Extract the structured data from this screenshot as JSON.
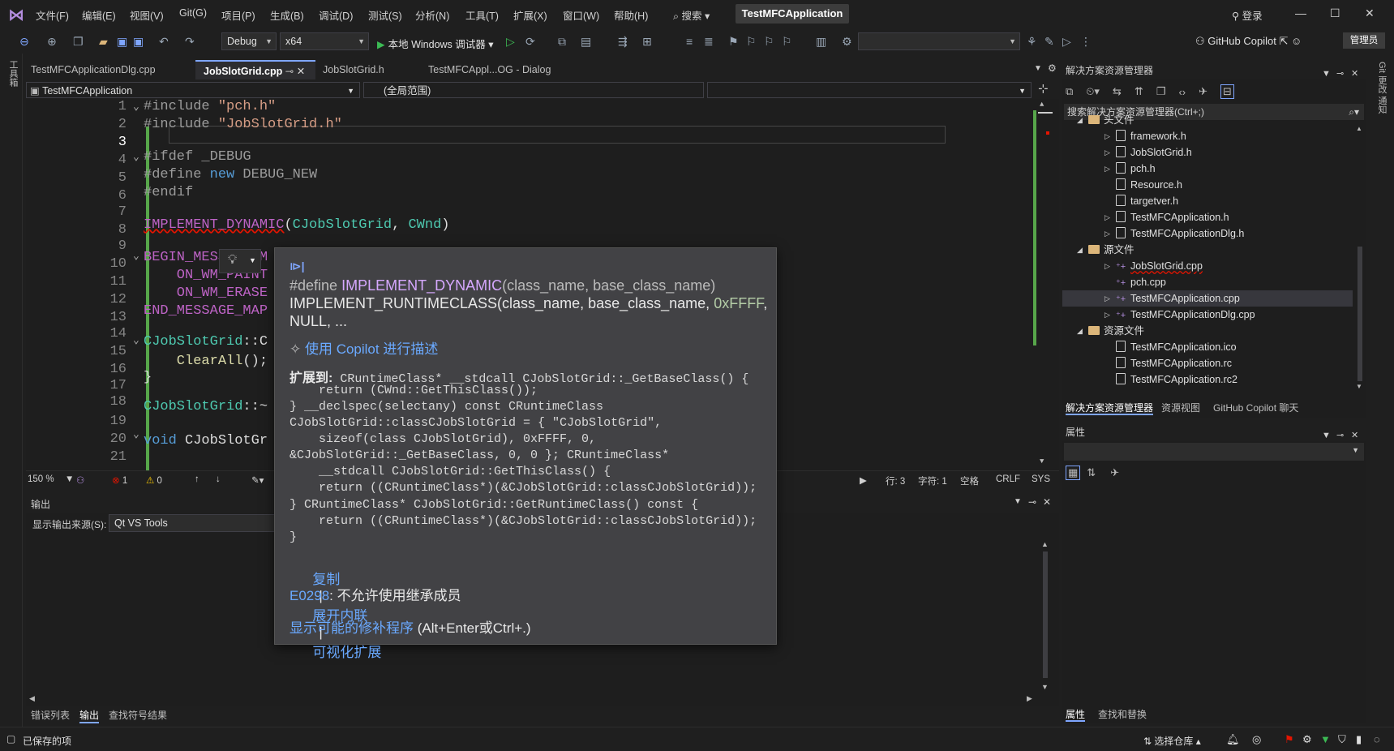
{
  "menubar": {
    "items": [
      "文件(F)",
      "编辑(E)",
      "视图(V)",
      "Git(G)",
      "项目(P)",
      "生成(B)",
      "调试(D)",
      "测试(S)",
      "分析(N)",
      "工具(T)",
      "扩展(X)",
      "窗口(W)",
      "帮助(H)"
    ],
    "search_label": "搜索",
    "solution_title": "TestMFCApplication",
    "login_label": "登录"
  },
  "toolbar": {
    "config": "Debug",
    "platform": "x64",
    "run_label": "本地 Windows 调试器",
    "copilot_label": "GitHub Copilot",
    "admin_label": "管理员"
  },
  "left_strip": {
    "label": "工具箱"
  },
  "right_strip": {
    "label": "Git 更改 通知"
  },
  "doc_tabs": [
    {
      "label": "TestMFCApplicationDlg.cpp",
      "active": false
    },
    {
      "label": "JobSlotGrid.cpp",
      "active": true
    },
    {
      "label": "JobSlotGrid.h",
      "active": false
    },
    {
      "label": "TestMFCAppl...OG - Dialog",
      "active": false
    }
  ],
  "navbar": {
    "project": "TestMFCApplication",
    "scope": "(全局范围)"
  },
  "code": {
    "line_numbers": [
      "1",
      "2",
      "3",
      "4",
      "5",
      "6",
      "7",
      "8",
      "9",
      "10",
      "11",
      "12",
      "13",
      "14",
      "15",
      "16",
      "17",
      "18",
      "19",
      "20",
      "21"
    ],
    "l1_pp": "#include",
    "l1_str": "\"pch.h\"",
    "l2_pp": "#include",
    "l2_str": "\"JobSlotGrid.h\"",
    "l4_pp": "#ifdef",
    "l4_rest": " _DEBUG",
    "l5_pp": "#define",
    "l5_kw": " new",
    "l5_rest": " DEBUG_NEW",
    "l6_pp": "#endif",
    "l8_mac": "IMPLEMENT_DYNAMIC",
    "l8_open": "(",
    "l8_cls1": "CJobSlotGrid",
    "l8_sep": ", ",
    "l8_cls2": "CWnd",
    "l8_close": ")",
    "l10": "BEGIN_MESSAGE_M",
    "l11": "    ON_WM_PAINT",
    "l12": "    ON_WM_ERASE",
    "l13": "END_MESSAGE_MAP",
    "l15_cls": "CJobSlotGrid",
    "l15_rest": "::C",
    "l16_fn": "    ClearAll",
    "l16_rest": "();",
    "l17": "}",
    "l19_cls": "CJobSlotGrid",
    "l19_rest": "::~",
    "l21_kw": "void",
    "l21_rest": " CJobSlotGr"
  },
  "editor_status": {
    "zoom": "150 %",
    "errors": "1",
    "warnings": "0",
    "line": "行: 3",
    "char": "字符: 1",
    "spaces": "空格",
    "eol": "CRLF",
    "encoding": "SYS"
  },
  "quickinfo": {
    "line1_pp": "#define",
    "line1_mac": "IMPLEMENT_DYNAMIC",
    "line1_args": "(class_name, base_class_name)",
    "line2a": "IMPLEMENT_RUNTIMECLASS(class_name, base_class_name, ",
    "line2_num": "0xFFFF",
    "line2b": ",",
    "line3": "NULL, ...",
    "copilot_link": "使用 Copilot 进行描述",
    "expand_label": "扩展到:",
    "expand_lines": [
      " CRuntimeClass* __stdcall CJobSlotGrid::_GetBaseClass() {",
      "    return (CWnd::GetThisClass());",
      "} __declspec(selectany) const CRuntimeClass",
      "CJobSlotGrid::classCJobSlotGrid = { \"CJobSlotGrid\",",
      "    sizeof(class CJobSlotGrid), 0xFFFF, 0,",
      "&CJobSlotGrid::_GetBaseClass, 0, 0 }; CRuntimeClass*",
      "    __stdcall CJobSlotGrid::GetThisClass() {",
      "    return ((CRuntimeClass*)(&CJobSlotGrid::classCJobSlotGrid));",
      "} CRuntimeClass* CJobSlotGrid::GetRuntimeClass() const {",
      "    return ((CRuntimeClass*)(&CJobSlotGrid::classCJobSlotGrid));",
      "}"
    ],
    "action_copy": "复制",
    "action_inline": "展开内联",
    "action_visualize": "可视化扩展",
    "sep": "|",
    "error_code": "E0298",
    "error_text": ": 不允许使用继承成员",
    "fix_link": "显示可能的修补程序",
    "fix_shortcut": " (Alt+Enter或Ctrl+.)"
  },
  "output": {
    "title": "输出",
    "source_label": "显示输出来源(S):",
    "source_value": "Qt VS Tools"
  },
  "bottom_tabs": [
    "错误列表",
    "输出",
    "查找符号结果"
  ],
  "statusbar": {
    "saved": "已保存的项",
    "repo": "选择仓库"
  },
  "solution_explorer": {
    "title": "解决方案资源管理器",
    "search_placeholder": "搜索解决方案资源管理器(Ctrl+;)",
    "header_folder": "头文件",
    "headers": [
      "framework.h",
      "JobSlotGrid.h",
      "pch.h",
      "Resource.h",
      "targetver.h",
      "TestMFCApplication.h",
      "TestMFCApplicationDlg.h"
    ],
    "source_folder": "源文件",
    "sources": [
      "JobSlotGrid.cpp",
      "pch.cpp",
      "TestMFCApplication.cpp",
      "TestMFCApplicationDlg.cpp"
    ],
    "resource_folder": "资源文件",
    "resources": [
      "TestMFCApplication.ico",
      "TestMFCApplication.rc",
      "TestMFCApplication.rc2"
    ],
    "tabs": [
      "解决方案资源管理器",
      "资源视图",
      "GitHub Copilot 聊天"
    ]
  },
  "properties": {
    "title": "属性",
    "tabs": [
      "属性",
      "查找和替换"
    ]
  },
  "colors": {
    "accent": "#7fa6ff",
    "change_bar": "#57a64a",
    "error": "#e51400"
  }
}
